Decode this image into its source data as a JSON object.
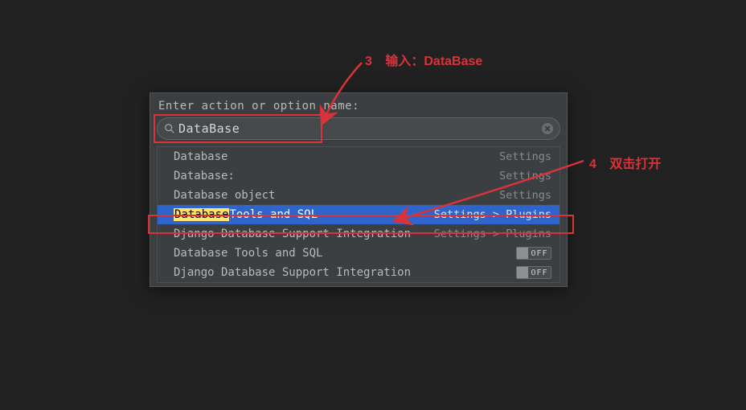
{
  "dialog": {
    "prompt": "Enter action or option name:",
    "search_value": "DataBase"
  },
  "results": [
    {
      "label": "Database",
      "hint": "Settings",
      "selected": false,
      "toggle": null
    },
    {
      "label": "Database:",
      "hint": "Settings",
      "selected": false,
      "toggle": null
    },
    {
      "label": "Database object",
      "hint": "Settings",
      "selected": false,
      "toggle": null
    },
    {
      "label_highlight": "Database",
      "label_rest": " Tools and SQL",
      "hint": "Settings > Plugins",
      "selected": true,
      "toggle": null
    },
    {
      "label": "Django Database Support Integration",
      "hint": "Settings > Plugins",
      "selected": false,
      "toggle": null
    },
    {
      "label": "Database Tools and SQL",
      "hint": "",
      "selected": false,
      "toggle": "OFF"
    },
    {
      "label": "Django Database Support Integration",
      "hint": "",
      "selected": false,
      "toggle": "OFF"
    }
  ],
  "annotations": {
    "a3_num": "3",
    "a3_text": "输入：DataBase",
    "a4_num": "4",
    "a4_text": "双击打开"
  },
  "colors": {
    "accent_red": "#d9333a",
    "selection_blue": "#2f65ca"
  }
}
